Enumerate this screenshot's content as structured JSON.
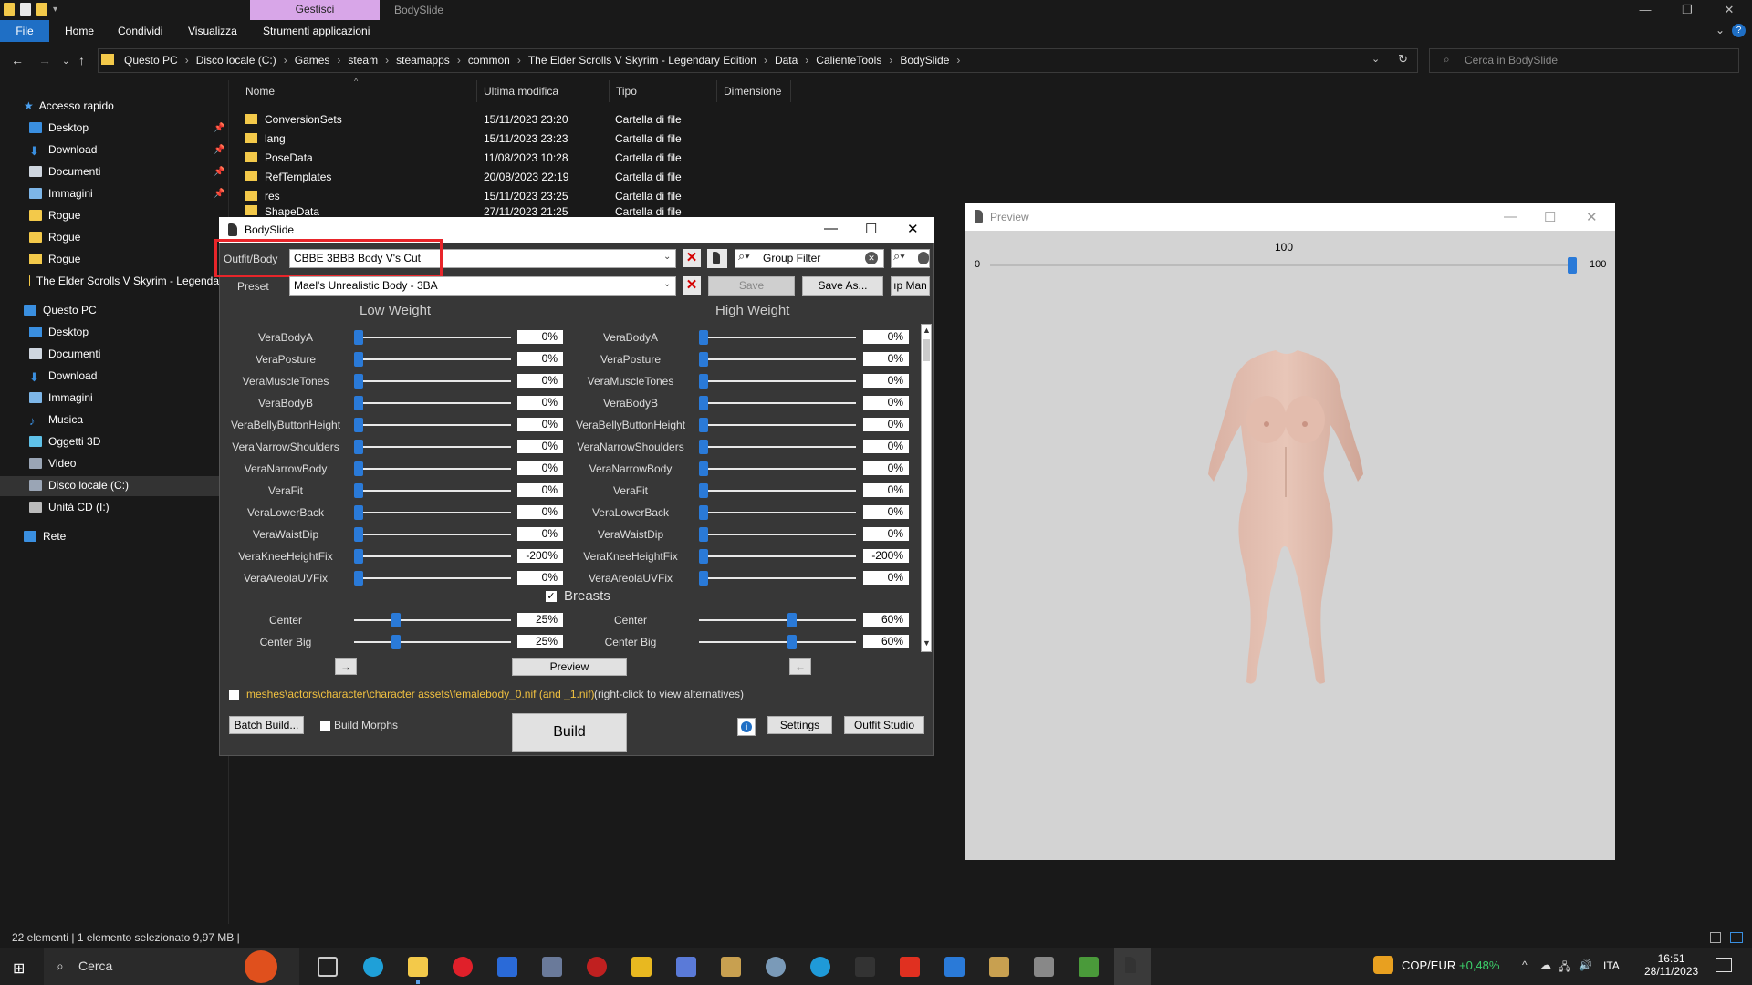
{
  "explorer": {
    "title_tab": "Gestisci",
    "window_title": "BodySlide",
    "ribbon": [
      "File",
      "Home",
      "Condividi",
      "Visualizza",
      "Strumenti applicazioni"
    ],
    "breadcrumbs": [
      "Questo PC",
      "Disco locale (C:)",
      "Games",
      "steam",
      "steamapps",
      "common",
      "The Elder Scrolls V Skyrim - Legendary Edition",
      "Data",
      "CalienteTools",
      "BodySlide"
    ],
    "search_placeholder": "Cerca in BodySlide",
    "nav": {
      "quick_access": "Accesso rapido",
      "items": [
        "Desktop",
        "Download",
        "Documenti",
        "Immagini",
        "Rogue",
        "Rogue",
        "Rogue",
        "The Elder Scrolls V Skyrim - Legenda"
      ],
      "this_pc": "Questo PC",
      "pc_items": [
        "Desktop",
        "Documenti",
        "Download",
        "Immagini",
        "Musica",
        "Oggetti 3D",
        "Video",
        "Disco locale (C:)",
        "Unità CD (I:)"
      ],
      "network": "Rete"
    },
    "columns": [
      "Nome",
      "Ultima modifica",
      "Tipo",
      "Dimensione"
    ],
    "files": [
      {
        "name": "ConversionSets",
        "date": "15/11/2023 23:20",
        "type": "Cartella di file"
      },
      {
        "name": "lang",
        "date": "15/11/2023 23:23",
        "type": "Cartella di file"
      },
      {
        "name": "PoseData",
        "date": "11/08/2023 10:28",
        "type": "Cartella di file"
      },
      {
        "name": "RefTemplates",
        "date": "20/08/2023 22:19",
        "type": "Cartella di file"
      },
      {
        "name": "res",
        "date": "15/11/2023 23:25",
        "type": "Cartella di file"
      },
      {
        "name": "ShapeData",
        "date": "27/11/2023 21:25",
        "type": "Cartella di file"
      }
    ],
    "status": "22 elementi   |   1 elemento selezionato  9,97 MB   |"
  },
  "bodyslide": {
    "title": "BodySlide",
    "outfit_label": "Outfit/Body",
    "outfit_value": "CBBE 3BBB Body V's Cut",
    "group_filter": "Group Filter",
    "preset_label": "Preset",
    "preset_value": "Mael's Unrealistic Body - 3BA",
    "save": "Save",
    "save_as": "Save As...",
    "group_man": "ıp Man",
    "low_weight": "Low Weight",
    "high_weight": "High Weight",
    "sliders": [
      {
        "name": "VeraBodyA",
        "low": "0%",
        "high": "0%",
        "lowpos": 0,
        "highpos": 0
      },
      {
        "name": "VeraPosture",
        "low": "0%",
        "high": "0%",
        "lowpos": 0,
        "highpos": 0
      },
      {
        "name": "VeraMuscleTones",
        "low": "0%",
        "high": "0%",
        "lowpos": 0,
        "highpos": 0
      },
      {
        "name": "VeraBodyB",
        "low": "0%",
        "high": "0%",
        "lowpos": 0,
        "highpos": 0
      },
      {
        "name": "VeraBellyButtonHeight",
        "low": "0%",
        "high": "0%",
        "lowpos": 0,
        "highpos": 0
      },
      {
        "name": "VeraNarrowShoulders",
        "low": "0%",
        "high": "0%",
        "lowpos": 0,
        "highpos": 0
      },
      {
        "name": "VeraNarrowBody",
        "low": "0%",
        "high": "0%",
        "lowpos": 0,
        "highpos": 0
      },
      {
        "name": "VeraFit",
        "low": "0%",
        "high": "0%",
        "lowpos": 0,
        "highpos": 0
      },
      {
        "name": "VeraLowerBack",
        "low": "0%",
        "high": "0%",
        "lowpos": 0,
        "highpos": 0
      },
      {
        "name": "VeraWaistDip",
        "low": "0%",
        "high": "0%",
        "lowpos": 0,
        "highpos": 0
      },
      {
        "name": "VeraKneeHeightFix",
        "low": "-200%",
        "high": "-200%",
        "lowpos": 0,
        "highpos": 0
      },
      {
        "name": "VeraAreolaUVFix",
        "low": "0%",
        "high": "0%",
        "lowpos": 0,
        "highpos": 0
      }
    ],
    "breasts_group": "Breasts",
    "breast_sliders": [
      {
        "name": "Center",
        "low": "25%",
        "high": "60%",
        "lowpos": 0.25,
        "highpos": 0.6
      },
      {
        "name": "Center Big",
        "low": "25%",
        "high": "60%",
        "lowpos": 0.25,
        "highpos": 0.6
      }
    ],
    "preview_btn": "Preview",
    "arrow_right": "→",
    "arrow_left": "←",
    "mesh_path": "meshes\\actors\\character\\character assets\\femalebody_0.nif (and _1.nif)",
    "mesh_hint": "(right-click to view alternatives)",
    "batch_build": "Batch Build...",
    "build_morphs": "Build Morphs",
    "build": "Build",
    "settings": "Settings",
    "outfit_studio": "Outfit Studio"
  },
  "preview": {
    "title": "Preview",
    "min": "0",
    "max": "100",
    "value": "100"
  },
  "taskbar": {
    "search": "Cerca",
    "ticker": "COP/EUR",
    "change": "+0,48%",
    "lang": "ITA",
    "time": "16:51",
    "date": "28/11/2023"
  }
}
